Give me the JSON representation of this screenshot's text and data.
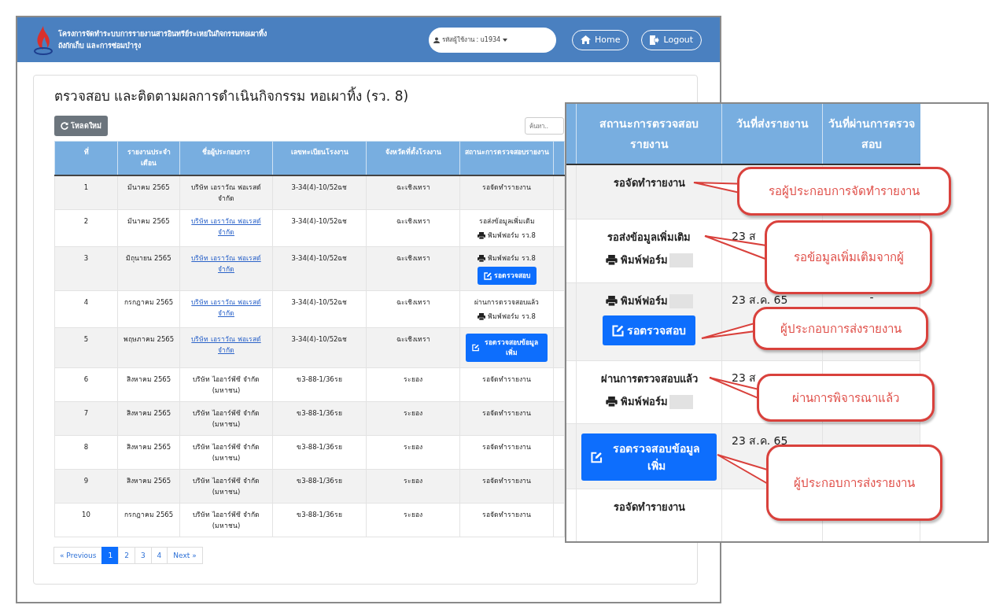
{
  "header": {
    "title_lines": [
      "โครงการจัดทำระบบการรายงานสารอินทรีย์ระเหยในกิจกรรมหอเผาทิ้ง",
      "ถังกักเก็บ และการซ่อมบำรุง"
    ],
    "user_menu": "รหัสผู้ใช้งาน : u1934",
    "home": "Home",
    "logout": "Logout"
  },
  "page": {
    "title": "ตรวจสอบ และติดตามผลการดำเนินกิจกรรม หอเผาทิ้ง (รว. 8)",
    "reload_button": "โหลดใหม่",
    "search": {
      "placeholder": "ค้นหา.."
    }
  },
  "table": {
    "columns": [
      "ที่",
      "รายงานประจำเดือน",
      "ชื่อผู้ประกอบการ",
      "เลขทะเบียนโรงงาน",
      "จังหวัดที่ตั้งโรงงาน",
      "สถานะการตรวจสอบรายงาน"
    ],
    "rows": [
      {
        "no": "1",
        "month": "มีนาคม 2565",
        "company": "บริษัท เอราวัณ ฟอเรสต์ จำกัด",
        "link": false,
        "reg": "3-34(4)-10/52ฉช",
        "province": "ฉะเชิงเทรา",
        "status": [
          {
            "kind": "text",
            "label": "รอจัดทำรายงาน"
          }
        ]
      },
      {
        "no": "2",
        "month": "มีนาคม 2565",
        "company": "บริษัท เอราวัณ ฟอเรสต์ จำกัด",
        "link": true,
        "reg": "3-34(4)-10/52ฉช",
        "province": "ฉะเชิงเทรา",
        "status": [
          {
            "kind": "text",
            "label": "รอส่งข้อมูลเพิ่มเติม"
          },
          {
            "kind": "print",
            "label": "พิมพ์ฟอร์ม รว.8"
          }
        ]
      },
      {
        "no": "3",
        "month": "มิถุนายน 2565",
        "company": "บริษัท เอราวัณ ฟอเรสต์ จำกัด",
        "link": true,
        "reg": "3-34(4)-10/52ฉช",
        "province": "ฉะเชิงเทรา",
        "status": [
          {
            "kind": "print",
            "label": "พิมพ์ฟอร์ม รว.8"
          },
          {
            "kind": "button",
            "label": "รอตรวจสอบ"
          }
        ]
      },
      {
        "no": "4",
        "month": "กรกฎาคม 2565",
        "company": "บริษัท เอราวัณ ฟอเรสต์ จำกัด",
        "link": true,
        "reg": "3-34(4)-10/52ฉช",
        "province": "ฉะเชิงเทรา",
        "status": [
          {
            "kind": "text",
            "label": "ผ่านการตรวจสอบแล้ว"
          },
          {
            "kind": "print",
            "label": "พิมพ์ฟอร์ม รว.8"
          }
        ]
      },
      {
        "no": "5",
        "month": "พฤษภาคม 2565",
        "company": "บริษัท เอราวัณ ฟอเรสต์ จำกัด",
        "link": true,
        "reg": "3-34(4)-10/52ฉช",
        "province": "ฉะเชิงเทรา",
        "status": [
          {
            "kind": "button",
            "label": "รอตรวจสอบข้อมูลเพิ่ม"
          }
        ]
      },
      {
        "no": "6",
        "month": "สิงหาคม 2565",
        "company": "บริษัท ไออาร์พีซี จำกัด (มหาชน)",
        "link": false,
        "reg": "ข3-88-1/36รย",
        "province": "ระยอง",
        "status": [
          {
            "kind": "text",
            "label": "รอจัดทำรายงาน"
          }
        ]
      },
      {
        "no": "7",
        "month": "สิงหาคม 2565",
        "company": "บริษัท ไออาร์พีซี จำกัด (มหาชน)",
        "link": false,
        "reg": "ข3-88-1/36รย",
        "province": "ระยอง",
        "status": [
          {
            "kind": "text",
            "label": "รอจัดทำรายงาน"
          }
        ]
      },
      {
        "no": "8",
        "month": "สิงหาคม 2565",
        "company": "บริษัท ไออาร์พีซี จำกัด (มหาชน)",
        "link": false,
        "reg": "ข3-88-1/36รย",
        "province": "ระยอง",
        "status": [
          {
            "kind": "text",
            "label": "รอจัดทำรายงาน"
          }
        ]
      },
      {
        "no": "9",
        "month": "สิงหาคม 2565",
        "company": "บริษัท ไออาร์พีซี จำกัด (มหาชน)",
        "link": false,
        "reg": "ข3-88-1/36รย",
        "province": "ระยอง",
        "status": [
          {
            "kind": "text",
            "label": "รอจัดทำรายงาน"
          }
        ]
      },
      {
        "no": "10",
        "month": "กรกฎาคม 2565",
        "company": "บริษัท ไออาร์พีซี จำกัด (มหาชน)",
        "link": false,
        "reg": "ข3-88-1/36รย",
        "province": "ระยอง",
        "status": [
          {
            "kind": "text",
            "label": "รอจัดทำรายงาน"
          }
        ]
      }
    ]
  },
  "pagination": {
    "previous": "« Previous",
    "next": "Next »",
    "pages": [
      {
        "label": "1",
        "selected": true
      },
      {
        "label": "2",
        "selected": false
      },
      {
        "label": "3",
        "selected": false
      },
      {
        "label": "4",
        "selected": false
      }
    ]
  },
  "inset": {
    "columns": [
      "สถานะการตรวจสอบรายงาน",
      "วันที่ส่งรายงาน",
      "วันที่ผ่านการตรวจสอบ"
    ],
    "rows": [
      {
        "status": [
          {
            "kind": "text",
            "label": "รอจัดทำรายงาน"
          }
        ]
      },
      {
        "status": [
          {
            "kind": "text",
            "label": "รอส่งข้อมูลเพิ่มเติม"
          },
          {
            "kind": "print",
            "label": "พิมพ์ฟอร์ม"
          }
        ],
        "sent_date": "23 ส"
      },
      {
        "status": [
          {
            "kind": "print",
            "label": "พิมพ์ฟอร์ม"
          },
          {
            "kind": "button",
            "label": "รอตรวจสอบ"
          }
        ],
        "sent_date": "23 ส.ค. 65",
        "pass_date": "-"
      },
      {
        "status": [
          {
            "kind": "text",
            "label": "ผ่านการตรวจสอบแล้ว"
          },
          {
            "kind": "print",
            "label": "พิมพ์ฟอร์ม"
          }
        ],
        "sent_date": "23 ส"
      },
      {
        "status": [
          {
            "kind": "button",
            "label": "รอตรวจสอบข้อมูลเพิ่ม"
          }
        ],
        "sent_date": "23 ส.ค. 65"
      },
      {
        "status": [
          {
            "kind": "text",
            "label": "รอจัดทำรายงาน"
          }
        ]
      }
    ],
    "callouts": [
      "รอผู้ประกอบการจัดทำรายงาน",
      "รอข้อมูลเพิ่มเติมจากผู้",
      "ผู้ประกอบการส่งรายงาน",
      "ผ่านการพิจารณาแล้ว",
      "ผู้ประกอบการส่งรายงาน"
    ]
  }
}
